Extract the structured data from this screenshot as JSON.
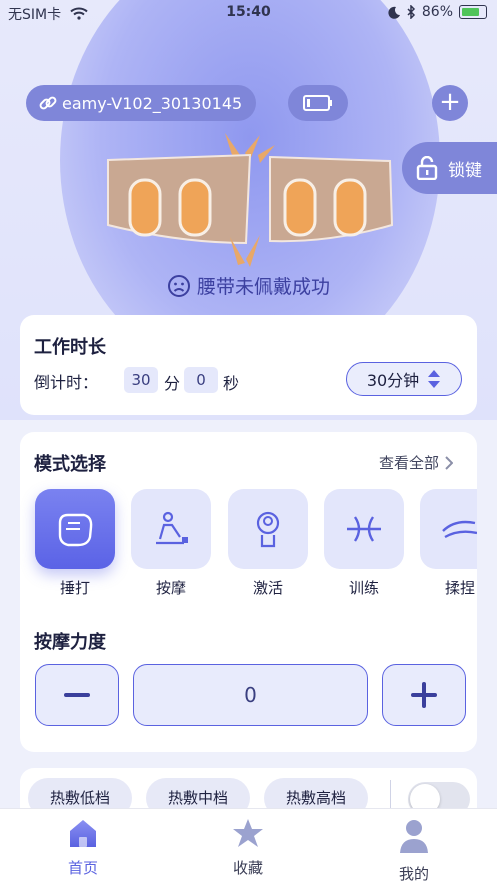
{
  "status_bar": {
    "carrier": "无SIM卡",
    "time": "15:40",
    "battery": "86%"
  },
  "header": {
    "device_name": "eamy-V102_30130145",
    "lock_label": "锁键"
  },
  "belt_status": {
    "message": "腰带未佩戴成功"
  },
  "work_duration": {
    "title": "工作时长",
    "countdown_label": "倒计时：",
    "minutes": "30",
    "minutes_unit": "分",
    "seconds": "0",
    "seconds_unit": "秒",
    "duration_select": "30分钟"
  },
  "mode": {
    "title": "模式选择",
    "view_all": "查看全部",
    "items": [
      {
        "label": "捶打",
        "icon": "fist-icon",
        "active": true
      },
      {
        "label": "按摩",
        "icon": "massage-icon",
        "active": false
      },
      {
        "label": "激活",
        "icon": "activate-icon",
        "active": false
      },
      {
        "label": "训练",
        "icon": "train-icon",
        "active": false
      },
      {
        "label": "揉捏",
        "icon": "knead-icon",
        "active": false
      }
    ]
  },
  "strength": {
    "title": "按摩力度",
    "value": "0"
  },
  "heat": {
    "levels": [
      "热敷低档",
      "热敷中档",
      "热敷高档"
    ]
  },
  "tabs": [
    {
      "label": "首页",
      "active": true
    },
    {
      "label": "收藏",
      "active": false
    },
    {
      "label": "我的",
      "active": false
    }
  ],
  "colors": {
    "accent": "#5a62e0",
    "pill": "#7f86d9",
    "card": "#ffffff"
  }
}
